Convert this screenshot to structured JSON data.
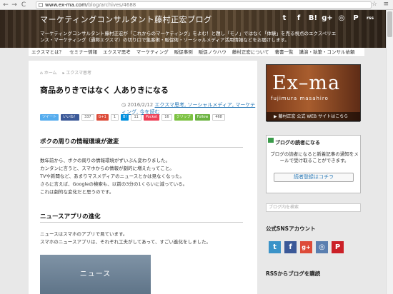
{
  "browser": {
    "back": "←",
    "forward": "→",
    "reload": "C",
    "url_host": "www.ex-ma.com",
    "url_path": "/blog/archives/4688",
    "star": "☆",
    "menu": "≡"
  },
  "header": {
    "title": "マーケティングコンサルタント藤村正宏ブログ",
    "tagline": "マーケティングコンサルタント藤村正宏が「これからのマーケティング」をよむ！と題し「モノ」ではなく「体験」を売る視点のエクスペリエンス・マーケティング（通称エクスマ）の切り口で集客術・販促術・ソーシャルメディア活用情報などをお届けします。",
    "social": [
      "t",
      "f",
      "B!",
      "g+",
      "◎",
      "P",
      "rss"
    ]
  },
  "nav": [
    "エクスマとは？",
    "セミナー情報",
    "エクスマ思考",
    "マーケティング",
    "販促事例",
    "販促ノウハウ",
    "藤村正宏について",
    "著書一覧",
    "講演・執筆・コンサル依頼"
  ],
  "article": {
    "breadcrumb": [
      "⌂ ホーム",
      "▸ エクスマ思考"
    ],
    "title": "商品ありきではなく 人ありきになる",
    "date": "◷ 2016/2/12",
    "tags": "エクスマ思考, ソーシャルメディア, マーケティング, 今を読む",
    "share": [
      {
        "label": "ツイート",
        "color": "#55acee"
      },
      {
        "label": "いいね！",
        "color": "#3b5998"
      },
      {
        "label": "337",
        "color": ""
      },
      {
        "label": "G+1",
        "color": "#dd4b39"
      },
      {
        "label": "1",
        "color": ""
      },
      {
        "label": "B!",
        "color": "#008fde"
      },
      {
        "label": "11",
        "color": ""
      },
      {
        "label": "Pocket",
        "color": "#ee4056"
      },
      {
        "label": "16",
        "color": ""
      },
      {
        "label": "クリップ",
        "color": "#7cc242"
      },
      {
        "label": "Follow",
        "color": "#6bb341"
      },
      {
        "label": "468",
        "color": ""
      }
    ],
    "h2_1": "ボクの周りの情報環境が激変",
    "p1": [
      "数年前から、ボクの周りの情報環境がずいぶん変わりました。",
      "カンタンに言うと、スマホからの情報が劇的に増えたってこと。",
      "TVや新聞など、あまりマスメディアのニュースとかは見なくなった。",
      "さらに言えば、Googleの検索も、以前の3分の1くらいに減っている。",
      "これは劇的な変化だと思うのです。"
    ],
    "h2_2": "ニュースアプリの進化",
    "p2": [
      "ニュースはスマホのアプリで見ています。",
      "スマホのニュースアプリは、それぞれ工夫がしてあって、すごい進化をしました。"
    ],
    "image_text": "ニュース"
  },
  "sidebar": {
    "banner_title": "Ex–ma",
    "banner_sub": "fujimura masahiro",
    "banner_note": "▶ 藤村正宏  公式 WEB サイトはこちら",
    "reader_heading": "ブログの読者になる",
    "reader_text": "ブログの読者になると新着記事の通知をメールで受け取ることができます。",
    "reader_button": "読者登録はコチラ",
    "search_placeholder": "ブログ内を検索",
    "sns_heading": "公式SNSアカウント",
    "sns": [
      {
        "icon": "t",
        "color": "#3b93c8"
      },
      {
        "icon": "f",
        "color": "#3b5998"
      },
      {
        "icon": "g+",
        "color": "#dd4b39"
      },
      {
        "icon": "◎",
        "color": "#5a7fb0"
      },
      {
        "icon": "P",
        "color": "#cb2027"
      }
    ],
    "rss_heading": "RSSからブログを購読"
  }
}
